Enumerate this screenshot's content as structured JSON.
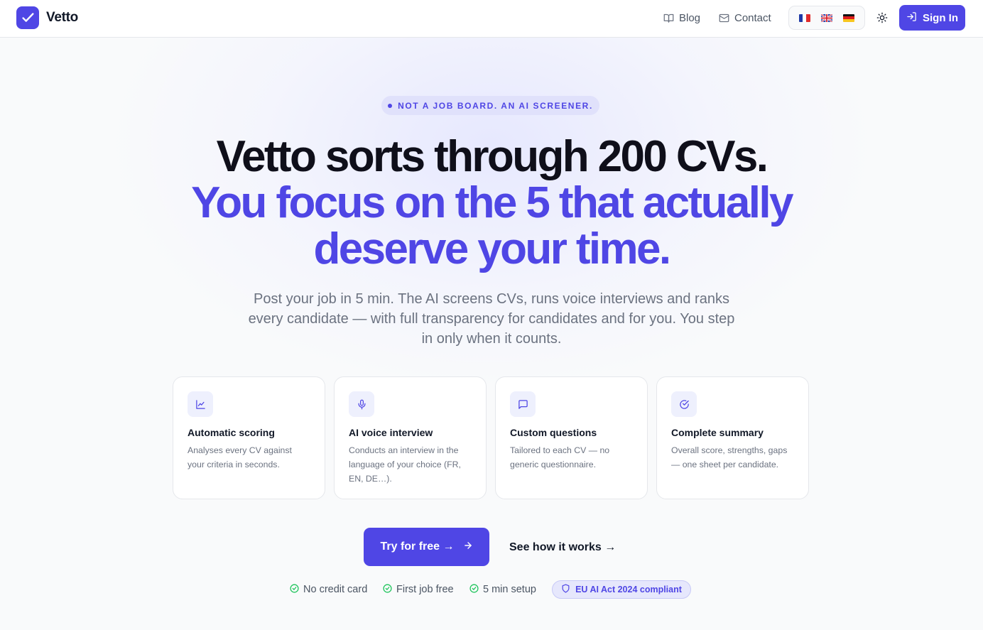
{
  "brand": {
    "name": "Vetto"
  },
  "nav": {
    "blog": "Blog",
    "contact": "Contact",
    "sign_in": "Sign In",
    "languages": [
      "fr-flag",
      "gb-flag",
      "de-flag"
    ]
  },
  "hero": {
    "badge": "NOT A JOB BOARD. AN AI SCREENER.",
    "headline_line1": "Vetto sorts through 200 CVs.",
    "headline_line2": "You focus on the 5 that actually",
    "headline_line3": "deserve your time.",
    "subtitle": "Post your job in 5 min. The AI screens CVs, runs voice interviews and ranks every candidate — with full transparency for candidates and for you. You step in only when it counts."
  },
  "features": [
    {
      "icon": "chart-line-icon",
      "title": "Automatic scoring",
      "description": "Analyses every CV against your criteria in seconds."
    },
    {
      "icon": "microphone-icon",
      "title": "AI voice interview",
      "description": "Conducts an interview in the language of your choice (FR, EN, DE…)."
    },
    {
      "icon": "message-square-icon",
      "title": "Custom questions",
      "description": "Tailored to each CV — no generic questionnaire."
    },
    {
      "icon": "check-circle-icon",
      "title": "Complete summary",
      "description": "Overall score, strengths, gaps — one sheet per candidate."
    }
  ],
  "cta": {
    "primary": "Try for free →",
    "secondary": "See how it works →"
  },
  "perks": [
    "No credit card",
    "First job free",
    "5 min setup"
  ],
  "compliance": "EU AI Act 2024 compliant",
  "colors": {
    "accent": "#4f46e5",
    "accent_soft": "#eef0fd",
    "success": "#22c55e",
    "text": "#111827",
    "muted": "#6b7280"
  }
}
